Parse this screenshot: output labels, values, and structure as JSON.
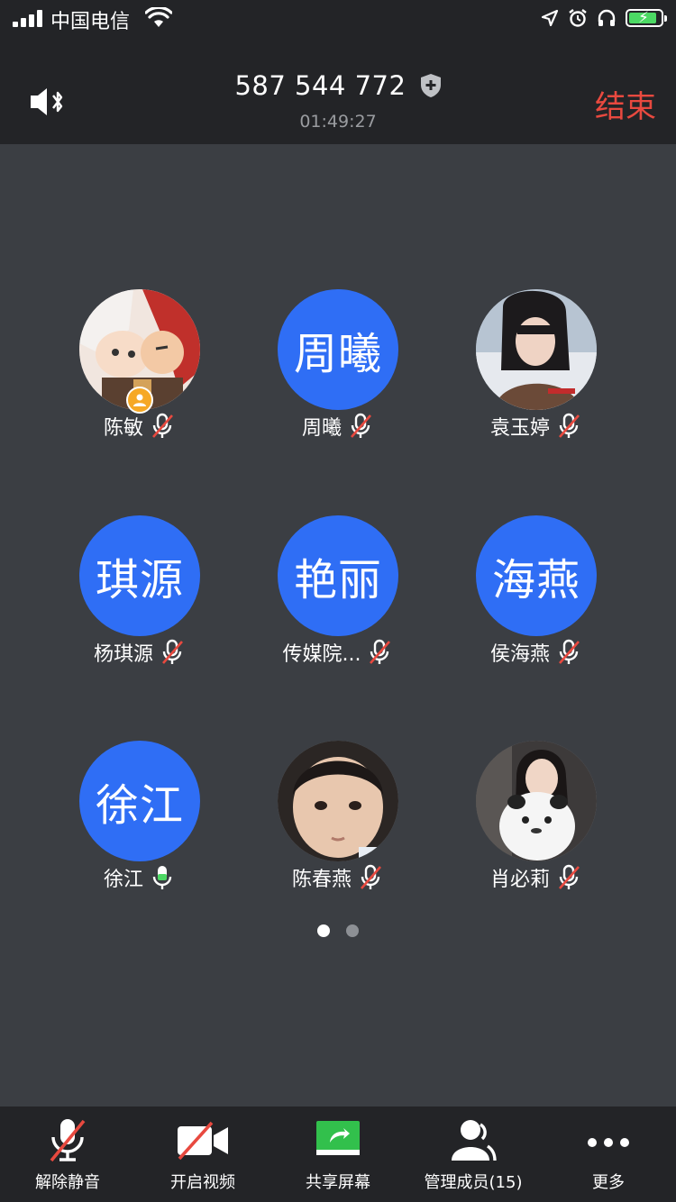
{
  "status_bar": {
    "carrier": "中国电信"
  },
  "header": {
    "meeting_id": "587 544 772",
    "duration": "01:49:27",
    "end_label": "结束"
  },
  "participants": [
    {
      "name": "陈敏",
      "avatar_text": "",
      "muted": true,
      "host": true
    },
    {
      "name": "周曦",
      "avatar_text": "周曦",
      "muted": true,
      "host": false
    },
    {
      "name": "袁玉婷",
      "avatar_text": "",
      "muted": true,
      "host": false
    },
    {
      "name": "杨琪源",
      "avatar_text": "琪源",
      "muted": true,
      "host": false
    },
    {
      "name": "传媒院...",
      "avatar_text": "艳丽",
      "muted": true,
      "host": false
    },
    {
      "name": "侯海燕",
      "avatar_text": "海燕",
      "muted": true,
      "host": false
    },
    {
      "name": "徐江",
      "avatar_text": "徐江",
      "muted": false,
      "host": false
    },
    {
      "name": "陈春燕",
      "avatar_text": "",
      "muted": true,
      "host": false
    },
    {
      "name": "肖必莉",
      "avatar_text": "",
      "muted": true,
      "host": false
    }
  ],
  "pager": {
    "pages": 2,
    "current": 1
  },
  "toolbar": {
    "unmute": "解除静音",
    "video": "开启视频",
    "share": "共享屏幕",
    "members": "管理成员(15)",
    "more": "更多"
  },
  "colors": {
    "accent_blue": "#2f6ef5",
    "end_red": "#e8493f",
    "mute_red": "#e8493f",
    "mic_green": "#4cd964",
    "share_green": "#32c04c"
  }
}
